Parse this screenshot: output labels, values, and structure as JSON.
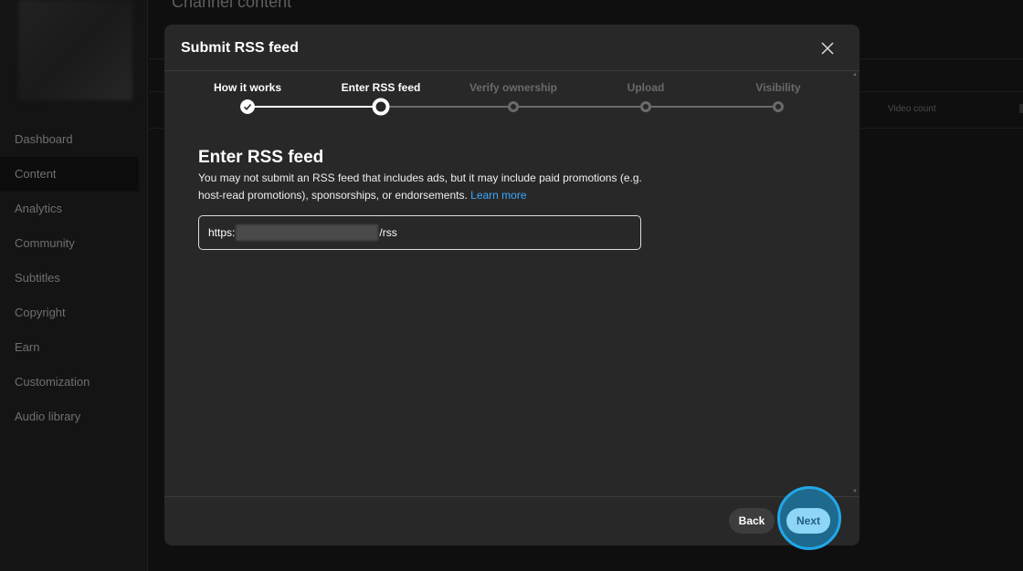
{
  "page": {
    "title": "Channel content",
    "column_header": "Video count"
  },
  "sidebar": {
    "items": [
      {
        "label": "Dashboard"
      },
      {
        "label": "Content",
        "active": true
      },
      {
        "label": "Analytics"
      },
      {
        "label": "Community"
      },
      {
        "label": "Subtitles"
      },
      {
        "label": "Copyright"
      },
      {
        "label": "Earn"
      },
      {
        "label": "Customization"
      },
      {
        "label": "Audio library"
      }
    ]
  },
  "dialog": {
    "title": "Submit RSS feed",
    "steps": [
      {
        "label": "How it works",
        "state": "completed"
      },
      {
        "label": "Enter RSS feed",
        "state": "current"
      },
      {
        "label": "Verify ownership",
        "state": "upcoming"
      },
      {
        "label": "Upload",
        "state": "upcoming"
      },
      {
        "label": "Visibility",
        "state": "upcoming"
      }
    ],
    "heading": "Enter RSS feed",
    "description": "You may not submit an RSS feed that includes ads, but it may include paid promotions (e.g. host-read promotions), sponsorships, or endorsements.",
    "learn_more": "Learn more",
    "input": {
      "prefix": "https:",
      "suffix": "/rss"
    },
    "back_label": "Back",
    "next_label": "Next"
  },
  "colors": {
    "accent": "#3ea6ff",
    "next_bg": "#8dd6f7",
    "highlight_ring": "#22a7e8"
  }
}
